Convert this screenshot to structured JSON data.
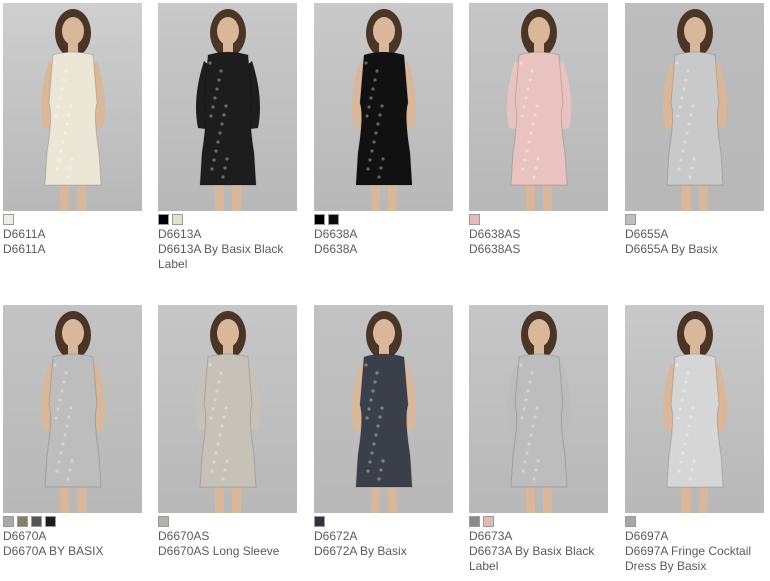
{
  "products": [
    {
      "sku": "D6611A",
      "name": "D6611A",
      "dress_color": "#ece6d6",
      "bg": "#cfcfcf",
      "sleeves": false,
      "swatches": [
        "#f0eee4"
      ]
    },
    {
      "sku": "D6613A",
      "name": "D6613A By Basix Black Label",
      "dress_color": "#1d1d1d",
      "bg": "#c8c8c8",
      "sleeves": true,
      "swatches": [
        "#000000",
        "#e8e0cc"
      ]
    },
    {
      "sku": "D6638A",
      "name": "D6638A",
      "dress_color": "#111111",
      "bg": "#c9c9c9",
      "sleeves": false,
      "swatches": [
        "#000000",
        "#0d0d1a"
      ]
    },
    {
      "sku": "D6638AS",
      "name": "D6638AS",
      "dress_color": "#e9c3c0",
      "bg": "#c6c6c6",
      "sleeves": true,
      "swatches": [
        "#e6b8b8"
      ]
    },
    {
      "sku": "D6655A",
      "name": "D6655A By Basix",
      "dress_color": "#c9c9c9",
      "bg": "#bdbdbd",
      "sleeves": false,
      "swatches": [
        "#bfbfbf"
      ]
    },
    {
      "sku": "D6670A",
      "name": "D6670A BY BASIX",
      "dress_color": "#bdbdbd",
      "bg": "#c3c3c3",
      "sleeves": false,
      "swatches": [
        "#a9a9a9",
        "#8a7d66",
        "#555555",
        "#1e1e1e"
      ]
    },
    {
      "sku": "D6670AS",
      "name": "D6670AS Long Sleeve",
      "dress_color": "#c7c2b8",
      "bg": "#c6c6c6",
      "sleeves": true,
      "swatches": [
        "#b5b0a8"
      ]
    },
    {
      "sku": "D6672A",
      "name": "D6672A By Basix",
      "dress_color": "#3b3f4a",
      "bg": "#c2c2c2",
      "sleeves": false,
      "swatches": [
        "#2f3440"
      ]
    },
    {
      "sku": "D6673A",
      "name": "D6673A By Basix Black Label",
      "dress_color": "#bdbdbd",
      "bg": "#c6c6c6",
      "sleeves": true,
      "swatches": [
        "#8a8a8a",
        "#e3b9b2"
      ]
    },
    {
      "sku": "D6697A",
      "name": "D6697A Fringe Cocktail Dress By Basix",
      "dress_color": "#d6d6d6",
      "bg": "#c9c9c9",
      "sleeves": false,
      "swatches": [
        "#a7a7a7"
      ]
    }
  ]
}
